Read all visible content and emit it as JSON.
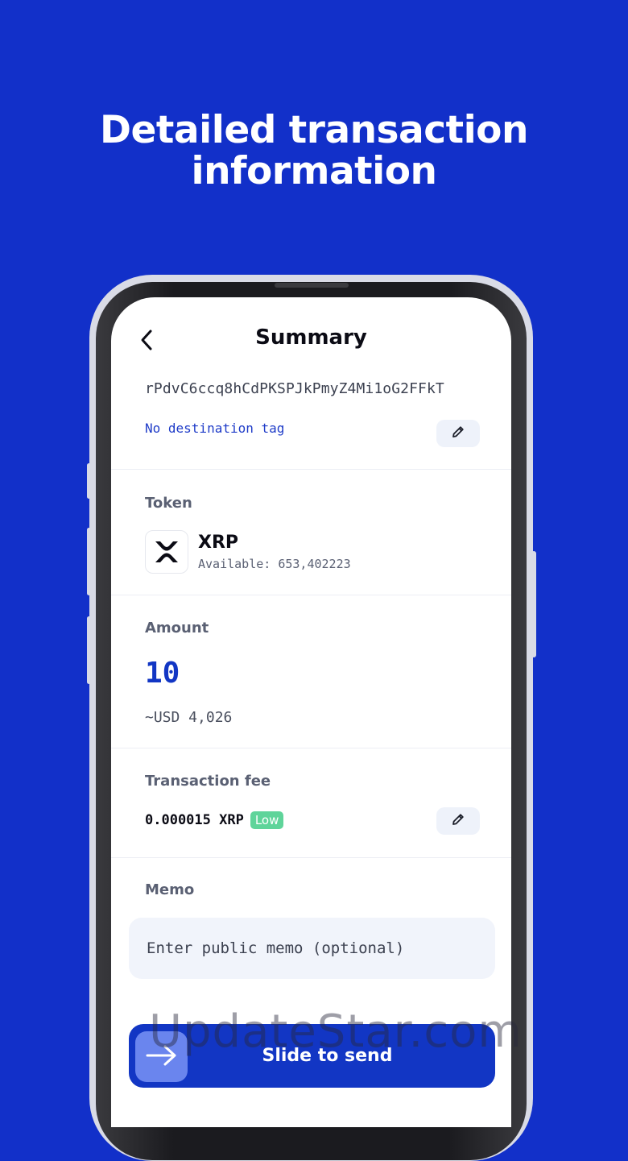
{
  "headline": {
    "line1": "Detailed transaction",
    "line2": "information"
  },
  "header": {
    "title": "Summary",
    "back_icon": "chevron-left-icon"
  },
  "recipient": {
    "address": "rPdvC6ccq8hCdPKSPJkPmyZ4Mi1oG2FFkT",
    "destination_tag": "No destination tag",
    "edit_icon": "pencil-icon"
  },
  "token": {
    "label": "Token",
    "name": "XRP",
    "available": "Available: 653,402223",
    "logo_icon": "xrp-logo-icon"
  },
  "amount": {
    "label": "Amount",
    "value": "10",
    "fiat": "~USD 4,026"
  },
  "fee": {
    "label": "Transaction fee",
    "value": "0.000015 XRP",
    "level": "Low",
    "edit_icon": "pencil-icon"
  },
  "memo": {
    "label": "Memo",
    "placeholder": "Enter public memo (optional)"
  },
  "send": {
    "label": "Slide to send",
    "handle_icon": "arrow-right-icon"
  },
  "watermark": "UpdateStar.com",
  "colors": {
    "background": "#1230c9",
    "accent": "#1236c4",
    "badge_low": "#5fd49a",
    "input_bg": "#f1f4fb"
  }
}
